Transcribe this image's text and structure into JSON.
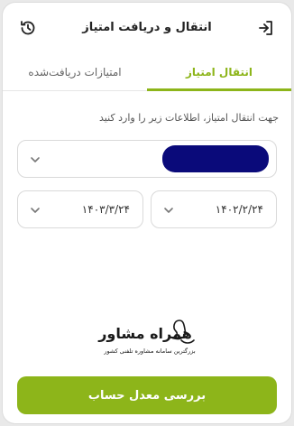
{
  "header": {
    "title": "انتقال و دریافت امتیاز",
    "exit_icon": "exit-icon",
    "history_icon": "history-icon"
  },
  "tabs": [
    {
      "label": "انتقال امتیاز",
      "active": true
    },
    {
      "label": "امتیازات دریافت‌شده",
      "active": false
    }
  ],
  "form": {
    "instruction": "جهت انتقال امتیاز، اطلاعات زیر را وارد کنید",
    "account_value": "",
    "date_from": "۱۴۰۲/۲/۲۴",
    "date_to": "۱۴۰۳/۳/۲۴"
  },
  "watermark": {
    "name": "همراه مشاور",
    "tagline": "بزرگترین سامانه مشاوره تلفنی کشور"
  },
  "submit_label": "بررسی معدل حساب",
  "colors": {
    "accent": "#8db51a",
    "redaction": "#0a0a7a"
  }
}
